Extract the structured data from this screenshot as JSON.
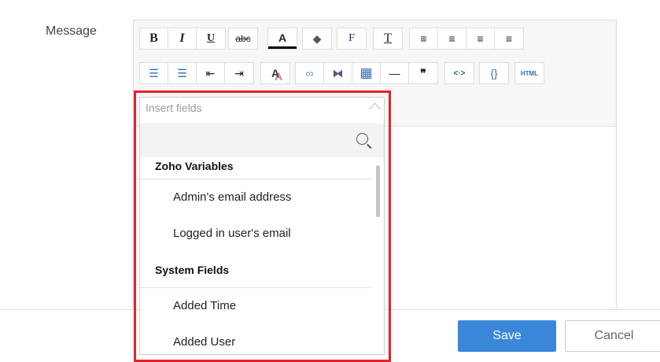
{
  "label": "Message",
  "toolbar": {
    "row1": [
      [
        "bold-button",
        "B"
      ],
      [
        "italic-button",
        "I"
      ],
      [
        "underline-button",
        "U"
      ],
      [
        "strikethrough-button",
        "abc"
      ],
      [
        "font-color-button",
        "A"
      ],
      [
        "background-color-button",
        "◆"
      ],
      [
        "font-family-button",
        "F"
      ],
      [
        "font-size-button",
        "T"
      ],
      [
        "align-left-button",
        "≡"
      ],
      [
        "align-right-button",
        "≡"
      ],
      [
        "justify-button",
        "≡"
      ],
      [
        "align-center-button",
        "≡"
      ]
    ],
    "row2": [
      [
        "bullet-list-button",
        "☰"
      ],
      [
        "numbered-list-button",
        "☰"
      ],
      [
        "outdent-button",
        "⇤"
      ],
      [
        "indent-button",
        "⇥"
      ],
      [
        "remove-format-button",
        "A"
      ],
      [
        "insert-link-button",
        "∞"
      ],
      [
        "unlink-button",
        "⧓"
      ],
      [
        "insert-table-button",
        "▦"
      ],
      [
        "horizontal-line-button",
        "—"
      ],
      [
        "blockquote-button",
        "❞"
      ],
      [
        "code-button",
        "<·>"
      ],
      [
        "source-button",
        "{}"
      ],
      [
        "html-button",
        "HTML"
      ]
    ]
  },
  "dropdown": {
    "placeholder": "Insert fields",
    "groups": [
      {
        "title": "Zoho Variables",
        "items": [
          "Admin's email address",
          "Logged in user's email"
        ]
      },
      {
        "title": "System Fields",
        "items": [
          "Added Time",
          "Added User"
        ]
      }
    ]
  },
  "buttons": {
    "save": "Save",
    "cancel": "Cancel"
  },
  "colors": {
    "accent": "#3a87d9",
    "highlight": "#e8202a"
  }
}
